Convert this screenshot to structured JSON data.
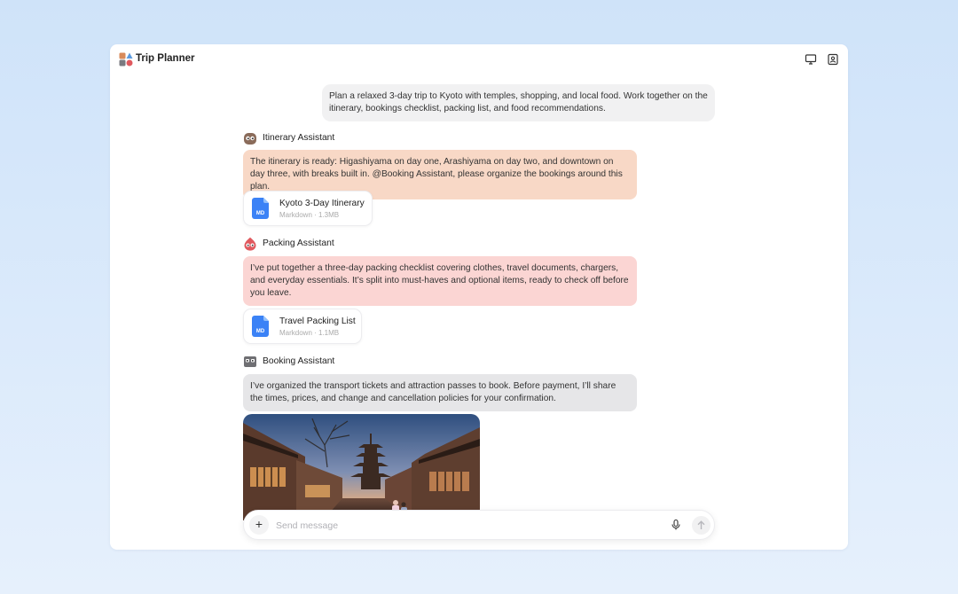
{
  "window": {
    "title": "Trip Planner",
    "actions": [
      {
        "icon": "monitor-icon"
      },
      {
        "icon": "contact-card-icon"
      }
    ]
  },
  "conversation": {
    "user_message": "Plan a relaxed 3-day trip to Kyoto with temples, shopping, and local food. Work together on the itinerary, bookings checklist, packing list, and food recommendations.",
    "agents": [
      {
        "name": "Itinerary Assistant",
        "avatar_color": "#8a6b5a",
        "bubble_color": "#f8d8c6",
        "message": "The itinerary is ready: Higashiyama on day one, Arashiyama on day two, and downtown on day three, with breaks built in. @Booking Assistant, please organize the bookings around this plan.",
        "attachment": {
          "name": "Kyoto 3-Day Itinerary",
          "meta": "Markdown · 1.3MB",
          "icon_label": "MD"
        }
      },
      {
        "name": "Packing Assistant",
        "avatar_color": "#e0595e",
        "bubble_color": "#fbd5d3",
        "message": "I’ve put together a three-day packing checklist covering clothes, travel documents, chargers, and everyday essentials. It’s split into must-haves and optional items, ready to check off before you leave.",
        "attachment": {
          "name": "Travel Packing List",
          "meta": "Markdown · 1.1MB",
          "icon_label": "MD"
        }
      },
      {
        "name": "Booking Assistant",
        "avatar_color": "#6f6f73",
        "bubble_color": "#e6e6e8",
        "message": "I’ve organized the transport tickets and attraction passes to book. Before payment, I’ll share the times, prices, and change and cancellation policies for your confirmation."
      }
    ]
  },
  "composer": {
    "placeholder": "Send message",
    "value": ""
  },
  "colors": {
    "accent_file": "#3b82f6"
  }
}
